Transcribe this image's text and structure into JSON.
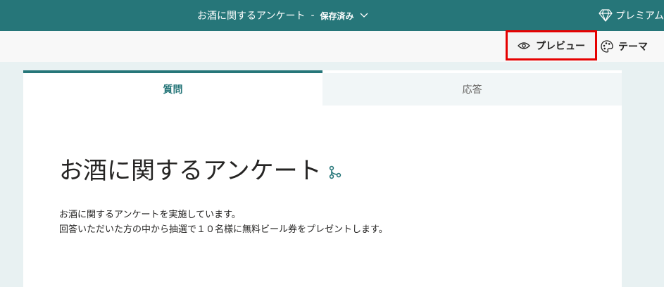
{
  "header": {
    "title": "お酒に関するアンケート",
    "separator": "-",
    "status": "保存済み",
    "premium_label": "プレミアム",
    "icons": [
      "chevron-down-icon",
      "diamond-icon"
    ]
  },
  "toolbar": {
    "preview_label": "プレビュー",
    "theme_label": "テーマ",
    "icons": [
      "eye-icon",
      "palette-icon"
    ]
  },
  "tabs": [
    {
      "label": "質問",
      "active": true
    },
    {
      "label": "応答",
      "active": false
    }
  ],
  "form": {
    "title": "お酒に関するアンケート",
    "description_line1": "お酒に関するアンケートを実施しています。",
    "description_line2": "回答いただいた方の中から抽選で１０名様に無料ビール券をプレゼントします。"
  },
  "colors": {
    "brand": "#267679",
    "highlight": "#e60000"
  }
}
